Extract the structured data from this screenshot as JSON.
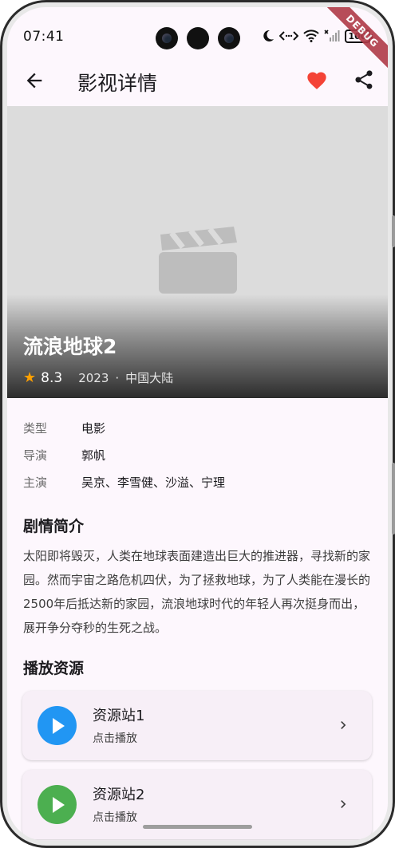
{
  "status_bar": {
    "time": "07:41",
    "battery": "100"
  },
  "debug_banner": "DEBUG",
  "app_bar": {
    "title": "影视详情"
  },
  "movie": {
    "title": "流浪地球2",
    "rating": "8.3",
    "year": "2023",
    "separator": "·",
    "region": "中国大陆"
  },
  "info": {
    "type_label": "类型",
    "type_value": "电影",
    "director_label": "导演",
    "director_value": "郭帆",
    "cast_label": "主演",
    "cast_value": "吴京、李雪健、沙溢、宁理"
  },
  "synopsis": {
    "heading": "剧情简介",
    "text": "太阳即将毁灭，人类在地球表面建造出巨大的推进器，寻找新的家园。然而宇宙之路危机四伏，为了拯救地球，为了人类能在漫长的2500年后抵达新的家园，流浪地球时代的年轻人再次挺身而出，展开争分夺秒的生死之战。"
  },
  "sources": {
    "heading": "播放资源",
    "items": [
      {
        "name": "资源站1",
        "subtitle": "点击播放",
        "color": "#2196F3"
      },
      {
        "name": "资源站2",
        "subtitle": "点击播放",
        "color": "#4CAF50"
      }
    ]
  },
  "colors": {
    "accent_heart": "#F44336",
    "star": "#FFA000",
    "background": "#FDF7FD"
  },
  "icons": [
    "back-arrow-icon",
    "heart-icon",
    "share-icon",
    "movie-clapper-icon",
    "star-icon",
    "play-icon",
    "chevron-right-icon"
  ]
}
